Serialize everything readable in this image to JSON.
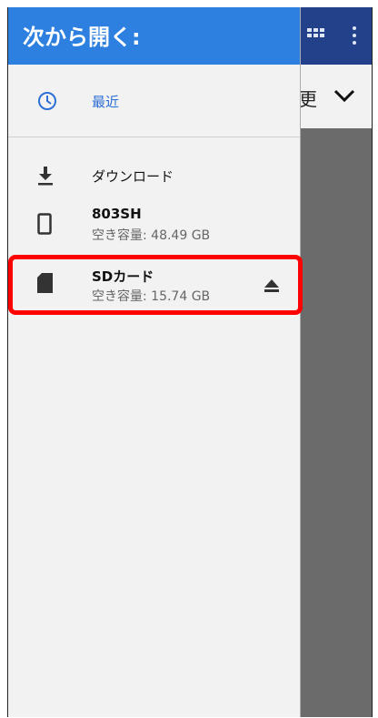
{
  "drawer": {
    "title": "次から開く:",
    "recent": {
      "label": "最近",
      "icon": "clock-icon"
    },
    "roots": [
      {
        "label": "ダウンロード",
        "icon": "download-icon"
      },
      {
        "label": "803SH",
        "free": "空き容量: 48.49 GB",
        "icon": "phone-icon"
      },
      {
        "label": "SDカード",
        "free": "空き容量: 15.74 GB",
        "icon": "sd-card-icon",
        "highlighted": true
      }
    ]
  },
  "background": {
    "sort_label": "更"
  },
  "colors": {
    "drawer_header": "#2e80e0",
    "accent_text": "#2e6fd6",
    "highlight": "#ff0000",
    "toolbar": "#23418a"
  }
}
